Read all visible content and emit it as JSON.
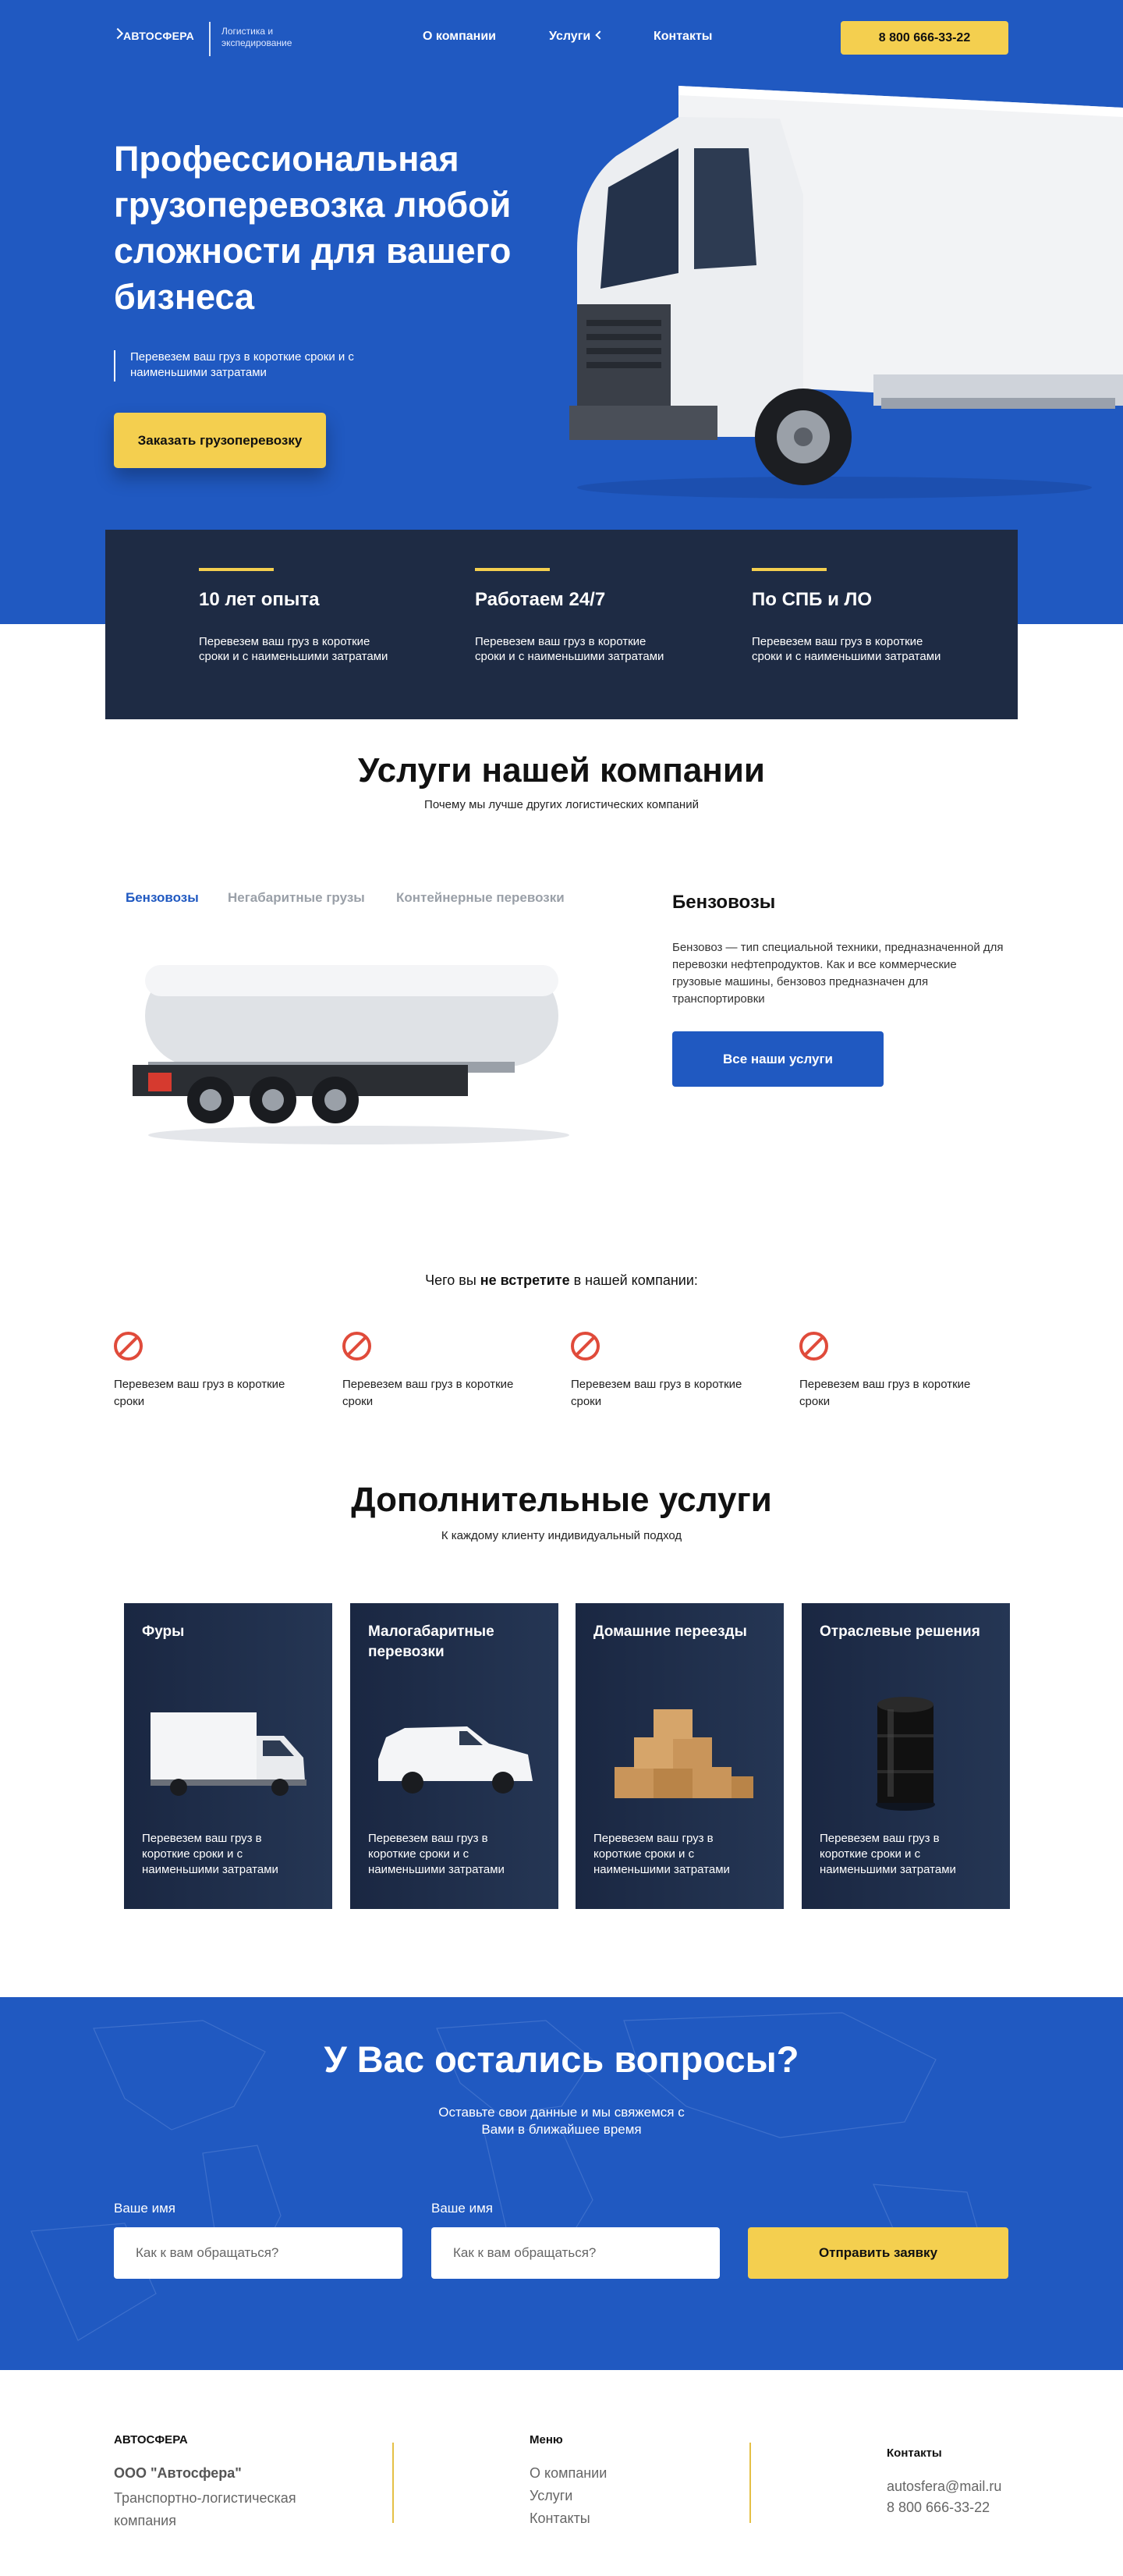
{
  "header": {
    "logo_name": "АВТОСФЕРА",
    "logo_tagline": "Логистика и экспедирование",
    "nav": [
      "О компании",
      "Услуги",
      "Контакты"
    ],
    "phone": "8 800 666-33-22"
  },
  "hero": {
    "title": "Профессиональная грузоперевозка любой сложности для вашего бизнеса",
    "subtitle": "Перевезем ваш груз в короткие сроки и с наименьшими затратами",
    "cta": "Заказать грузоперевозку"
  },
  "stats": [
    {
      "title": "10 лет опыта",
      "text": "Перевезем ваш груз в короткие сроки и с наименьшими затратами"
    },
    {
      "title": "Работаем 24/7",
      "text": "Перевезем ваш груз в короткие сроки и с наименьшими затратами"
    },
    {
      "title": "По СПБ и ЛО",
      "text": "Перевезем ваш груз в короткие сроки и с наименьшими затратами"
    }
  ],
  "services": {
    "title": "Услуги нашей компании",
    "subtitle": "Почему мы лучше других логистических компаний",
    "tabs": [
      "Бензовозы",
      "Негабаритные грузы",
      "Контейнерные перевозки"
    ],
    "active_tab": "Бензовозы",
    "detail_title": "Бензовозы",
    "detail_text": "Бензовоз — тип специальной техники, предназначенной для перевозки нефтепродуктов. Как и все коммерческие грузовые машины, бензовоз предназначен для транспортировки",
    "button": "Все наши услуги"
  },
  "not_meet": {
    "prefix": "Чего вы ",
    "bold": "не встретите",
    "suffix": " в нашей компании:",
    "items": [
      "Перевезем ваш груз в короткие сроки",
      "Перевезем ваш груз в короткие сроки",
      "Перевезем ваш груз в короткие сроки",
      "Перевезем ваш груз в короткие сроки"
    ]
  },
  "extra": {
    "title": "Дополнительные услуги",
    "subtitle": "К каждому клиенту индивидуальный подход",
    "cards": [
      {
        "title": "Фуры",
        "text": "Перевезем ваш груз в короткие сроки и с наименьшими затратами"
      },
      {
        "title": "Малогабаритные перевозки",
        "text": "Перевезем ваш груз в короткие сроки и с наименьшими затратами"
      },
      {
        "title": "Домашние переезды",
        "text": "Перевезем ваш груз в короткие сроки и с наименьшими затратами"
      },
      {
        "title": "Отраслевые решения",
        "text": "Перевезем ваш груз в короткие сроки и с наименьшими затратами"
      }
    ]
  },
  "cta": {
    "title": "У Вас остались вопросы?",
    "subtitle": "Оставьте свои данные и мы свяжемся с Вами в ближайшее время",
    "field1_label": "Ваше имя",
    "field1_placeholder": "Как к вам обращаться?",
    "field2_label": "Ваше имя",
    "field2_placeholder": "Как к вам обращаться?",
    "button": "Отправить заявку"
  },
  "footer": {
    "brand": "АВТОСФЕРА",
    "company": "ООО \"Автосфера\"",
    "description": "Транспортно-логистическая компания",
    "menu_title": "Меню",
    "menu": [
      "О компании",
      "Услуги",
      "Контакты"
    ],
    "contacts_title": "Контакты",
    "email": "autosfera@mail.ru",
    "phone": "8 800 666-33-22"
  },
  "colors": {
    "primary": "#2059c1",
    "accent": "#f4cf4f",
    "dark": "#1e2b44",
    "danger": "#e04b3b"
  }
}
